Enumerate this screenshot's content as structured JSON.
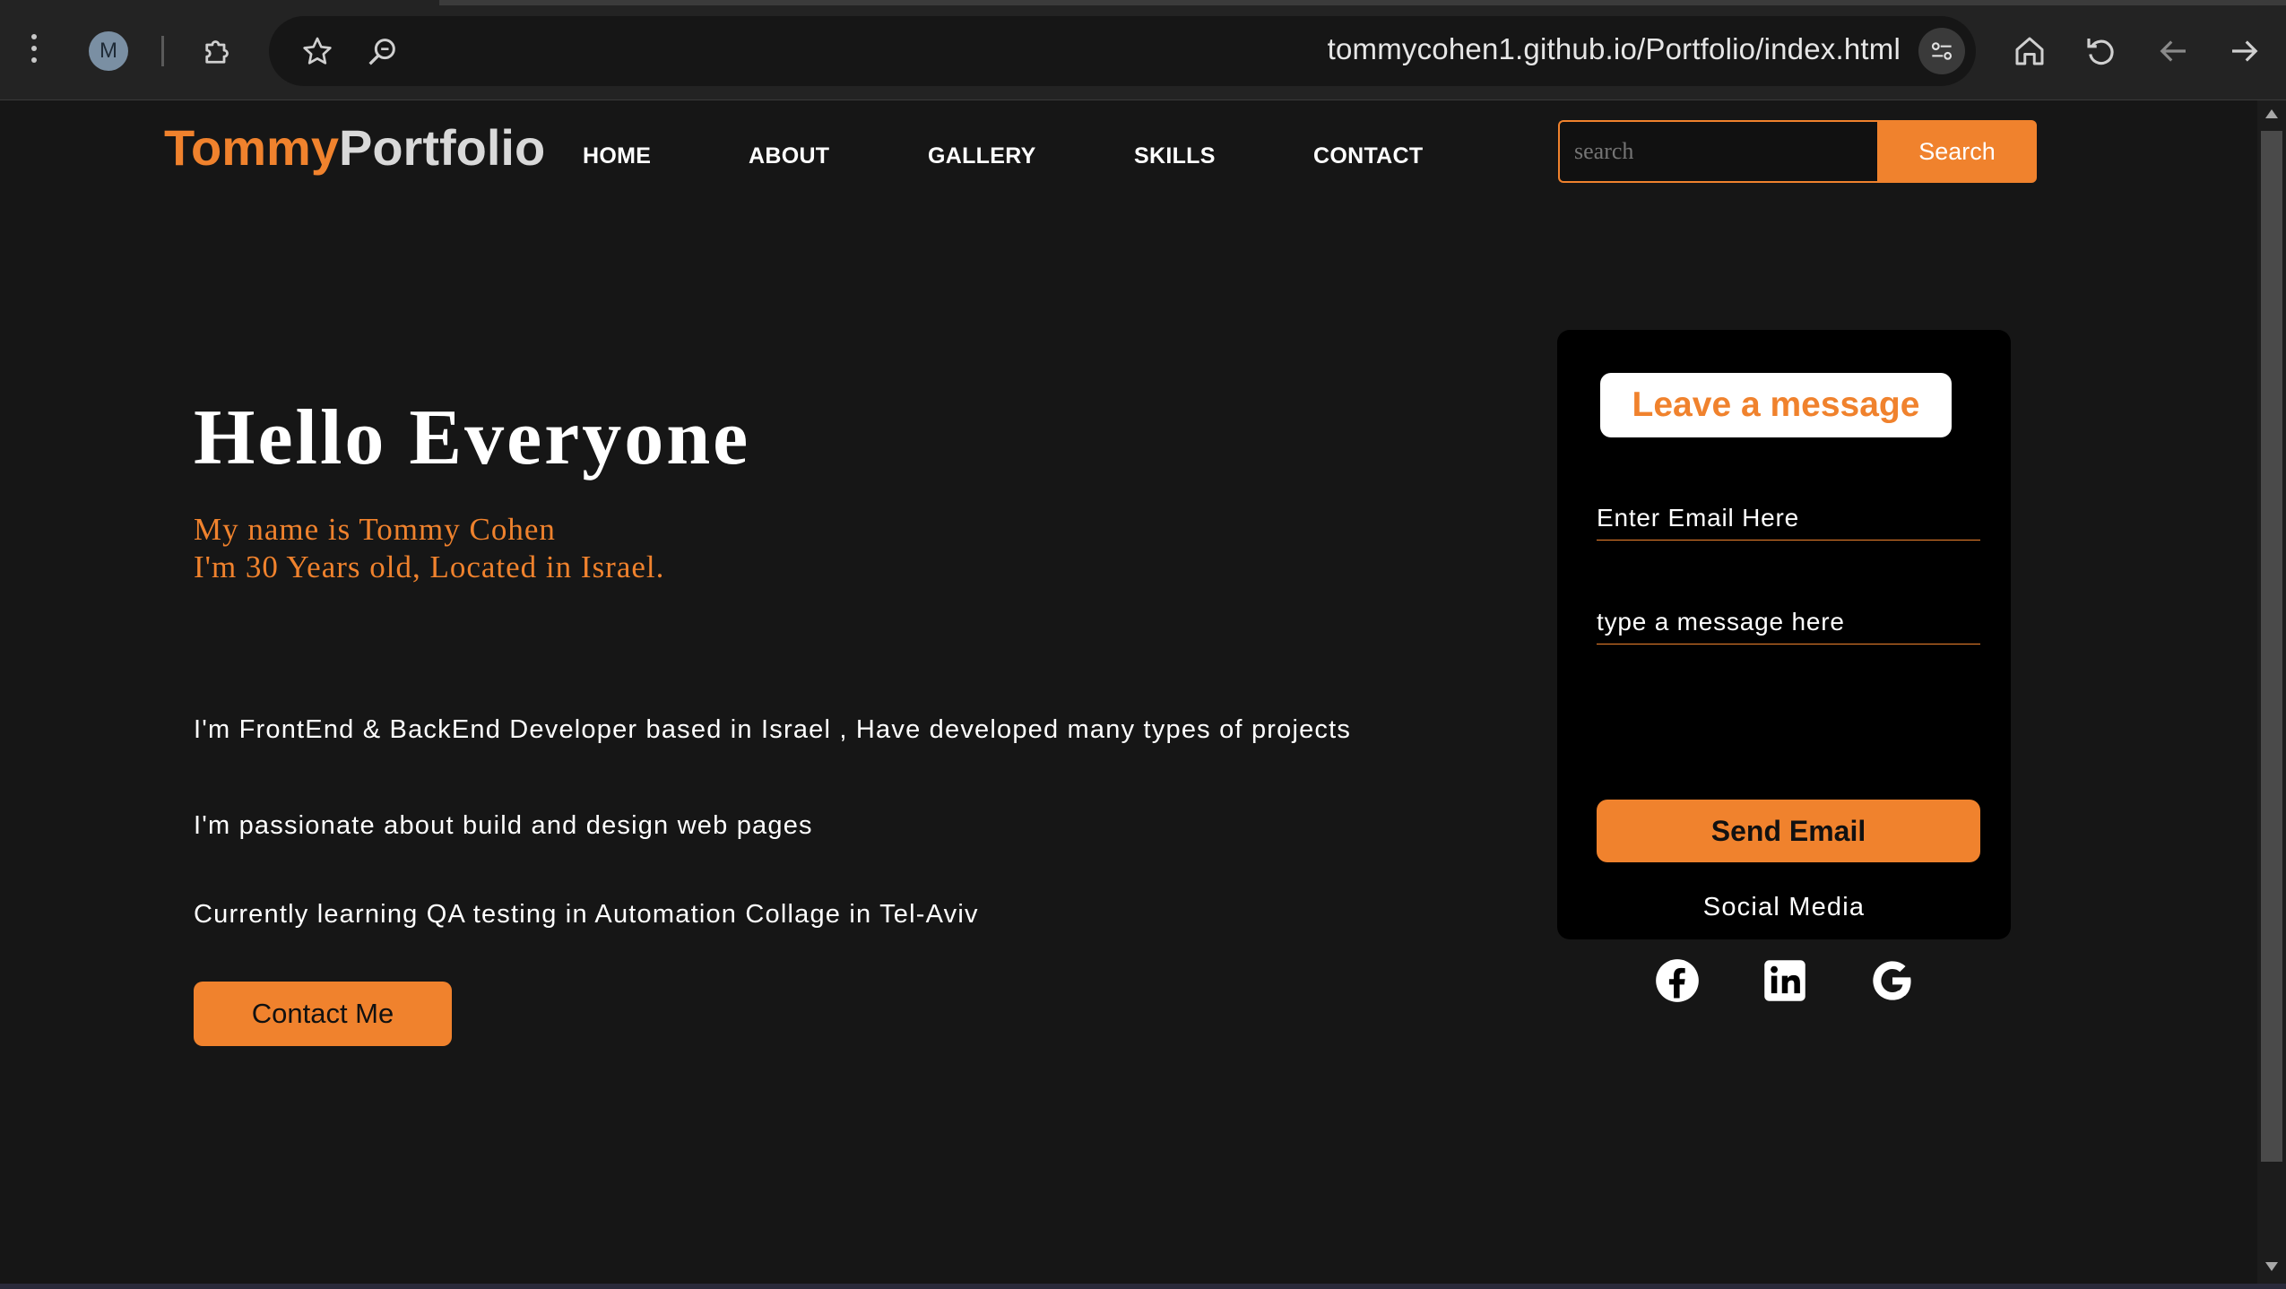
{
  "browser": {
    "profile_initial": "M",
    "url": "tommycohen1.github.io/Portfolio/index.html"
  },
  "site": {
    "logo_part1": "Tommy",
    "logo_part2": "Portfolio",
    "nav": [
      "HOME",
      "ABOUT",
      "GALLERY",
      "SKILLS",
      "CONTACT"
    ],
    "search_placeholder": "search",
    "search_button": "Search",
    "accent_color": "#f0822d"
  },
  "hero": {
    "title": "Hello Everyone",
    "intro_line1": "My name is Tommy Cohen",
    "intro_line2": "I'm 30 Years old, Located in Israel.",
    "paragraphs": [
      "I'm FrontEnd & BackEnd Developer based in Israel , Have developed many types of projects",
      "I'm passionate about build and design web pages",
      "Currently learning QA testing in Automation Collage in Tel-Aviv"
    ],
    "contact_button": "Contact Me"
  },
  "message_card": {
    "title": "Leave a message",
    "email_placeholder": "Enter Email Here",
    "message_placeholder": "type a message here",
    "send_button": "Send Email",
    "social_title": "Social Media",
    "social_icons": [
      "facebook-icon",
      "linkedin-icon",
      "google-icon"
    ]
  }
}
